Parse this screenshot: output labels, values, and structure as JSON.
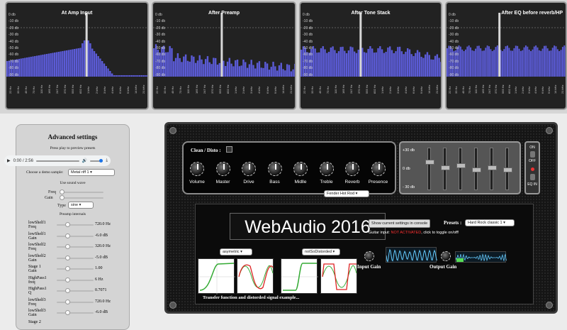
{
  "analyzers": [
    {
      "title": "At Amp Input",
      "db_labels": [
        "0 db",
        "-10 db",
        "-20 db",
        "-30 db",
        "-40 db",
        "-50 db",
        "-60 db",
        "-70 db",
        "-80 db",
        "-90 db"
      ],
      "hz_labels": [
        "22 Hz",
        "33 Hz",
        "49 Hz",
        "73 Hz",
        "110 Hz",
        "165 Hz",
        "247 Hz",
        "370 Hz",
        "555 Hz",
        "832 Hz",
        "1 kHz",
        "2 kHz",
        "3 kHz",
        "4 kHz",
        "6 kHz",
        "9 kHz",
        "14 kHz",
        "21 kHz"
      ]
    },
    {
      "title": "After Preamp",
      "db_labels": [
        "0 db",
        "-10 db",
        "-20 db",
        "-30 db",
        "-40 db",
        "-50 db",
        "-60 db",
        "-70 db",
        "-80 db",
        "-90 db"
      ],
      "hz_labels": [
        "22 Hz",
        "33 Hz",
        "49 Hz",
        "73 Hz",
        "110 Hz",
        "165 Hz",
        "247 Hz",
        "370 Hz",
        "555 Hz",
        "832 Hz",
        "1 kHz",
        "2 kHz",
        "3 kHz",
        "4 kHz",
        "6 kHz",
        "9 kHz",
        "14 kHz",
        "21 kHz"
      ]
    },
    {
      "title": "After Tone Stack",
      "db_labels": [
        "0 db",
        "-10 db",
        "-20 db",
        "-30 db",
        "-40 db",
        "-50 db",
        "-60 db",
        "-70 db",
        "-80 db",
        "-90 db"
      ],
      "hz_labels": [
        "22 Hz",
        "33 Hz",
        "49 Hz",
        "73 Hz",
        "110 Hz",
        "165 Hz",
        "247 Hz",
        "370 Hz",
        "555 Hz",
        "832 Hz",
        "1 kHz",
        "2 kHz",
        "3 kHz",
        "4 kHz",
        "6 kHz",
        "9 kHz",
        "14 kHz",
        "21 kHz"
      ]
    },
    {
      "title": "After EQ before reverb/HP",
      "db_labels": [
        "0 db",
        "-10 db",
        "-20 db",
        "-30 db",
        "-40 db",
        "-50 db",
        "-60 db",
        "-70 db",
        "-80 db",
        "-90 db"
      ],
      "hz_labels": [
        "22 Hz",
        "33 Hz",
        "49 Hz",
        "73 Hz",
        "110 Hz",
        "165 Hz",
        "247 Hz",
        "370 Hz",
        "555 Hz",
        "832 Hz",
        "1 kHz",
        "2 kHz",
        "3 kHz",
        "4 kHz",
        "6 kHz",
        "9 kHz",
        "14 kHz",
        "21 kHz"
      ]
    }
  ],
  "settings": {
    "title": "Advanced settings",
    "press_play": "Press play to preview presets",
    "player_time": "0:00 / 2:56",
    "demo_label": "Choose a demo sample:",
    "demo_value": "Metal riff 1",
    "sound_wave": "Use sound wave",
    "freq_label": "Freq",
    "gain_label": "Gain",
    "type_label": "Type",
    "type_value": "sine",
    "preamp": "Preamp internals",
    "params": [
      {
        "label": "lowShelf1\nFreq",
        "value": "720.0 Hz"
      },
      {
        "label": "lowShelf1\nGain",
        "value": "-6.0 dB"
      },
      {
        "label": "lowShelf2\nFreq",
        "value": "320.0 Hz"
      },
      {
        "label": "lowShelf2\nGain",
        "value": "-5.0 dB"
      },
      {
        "label": "Stage 1\nGain",
        "value": "1.00"
      },
      {
        "label": "HighPass1\nfreq",
        "value": "6 Hz"
      },
      {
        "label": "HighPass1\nQ",
        "value": "0.7071"
      },
      {
        "label": "lowShelf3\nFreq",
        "value": "720.0 Hz"
      },
      {
        "label": "lowShelf3\nGain",
        "value": "-6.0 dB"
      },
      {
        "label": "Stage 2",
        "value": ""
      }
    ]
  },
  "amp": {
    "clean_disto": "Clean / Disto :",
    "knobs": [
      "Volume",
      "Master",
      "Drive",
      "Bass",
      "Midlle",
      "Treble",
      "Reverb",
      "Presence"
    ],
    "distortion_select": "Fender Hot Rod",
    "eq_labels": [
      "+30 db",
      "0 db",
      "- 30 db"
    ],
    "eq_levels": [
      0.3,
      0.45,
      0.4,
      0.5,
      0.45,
      0.5
    ],
    "switch_on": "ON",
    "switch_off": "OFF",
    "eq_in": "EQ IN",
    "title": "WebAudio 2016",
    "show_settings": "Show current settings in console",
    "presets_label": "Presets :",
    "preset_value": "Hard Rock classic 1",
    "guitar_input_prefix": "Guitar input: ",
    "guitar_input_status": "NOT ACTIVATED",
    "guitar_input_suffix": ", click to toggle on/off!",
    "curve1": "asymetric",
    "curve2": "notSoDistorded",
    "input_gain": "Input Gain",
    "output_gain": "Output Gain",
    "transfer_caption": "Transfer function and distorded signal example..."
  }
}
